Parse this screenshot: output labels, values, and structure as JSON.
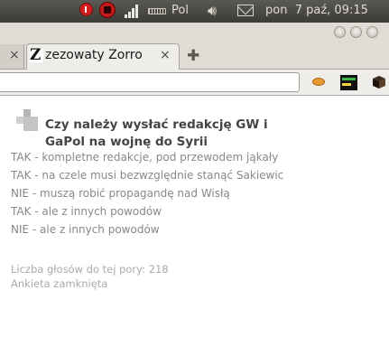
{
  "system_panel": {
    "keyboard_layout": "Pol",
    "clock": "pon  7 paź, 09:15"
  },
  "browser": {
    "active_tab_title": "zezowaty Zorro",
    "active_tab_favicon_letter": "Z",
    "tab_close_glyph": "×",
    "new_tab_glyph": "✚"
  },
  "poll": {
    "question": "Czy należy wysłać redakcję GW i GaPol na wojnę do Syrii",
    "options": [
      "TAK - kompletne redakcje, pod przewodem jąkały",
      "TAK - na czele musi bezwzględnie stanąć Sakiewic",
      "NIE - muszą robić propagandę nad Wisłą",
      "TAK - ale z innych powodów",
      "NIE - ale z innych powodów"
    ],
    "votes_label": "Liczba głosów do tej pory: 218",
    "status": "Ankieta zamknięta"
  },
  "colors": {
    "panel": "#3c3b37",
    "window_chrome": "#dfdcd6",
    "option_text": "#888888",
    "question_text": "#444444",
    "record_red": "#d41e1e"
  },
  "icons": [
    "record-icon",
    "stop-record-icon",
    "signal-icon",
    "keyboard-icon",
    "volume-icon",
    "mail-icon",
    "window-button-icon",
    "tab-close-icon",
    "new-tab-icon",
    "extension-icon",
    "poll-logo-icon"
  ]
}
